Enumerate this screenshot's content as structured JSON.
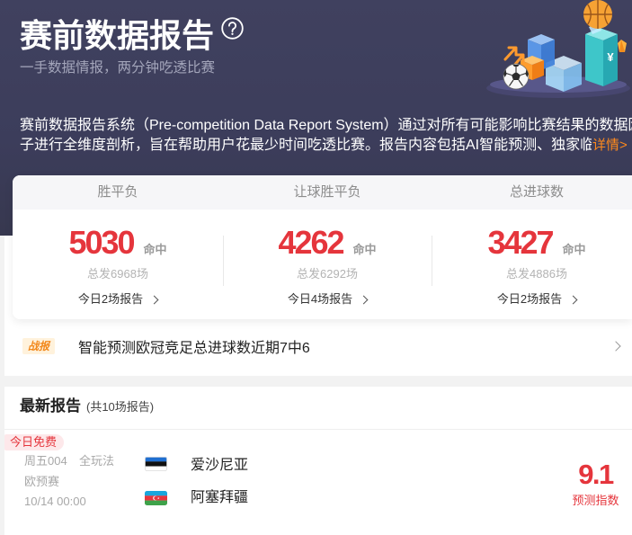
{
  "header": {
    "title": "赛前数据报告",
    "subtitle": "一手数据情报，两分钟吃透比赛",
    "description_lines": [
      "赛前数据报告系统（Pre-competition Data Report System）通过对所有可能影响比赛结果的数据因",
      "子进行全维度剖析，旨在帮助用户花最少时间吃透比赛。报告内容包括AI智能预测、独家临"
    ],
    "details_link": "详情>",
    "illustration": {
      "currency_symbol": "¥"
    }
  },
  "stats": {
    "columns": [
      {
        "label": "胜平负",
        "hits": "5030",
        "hit_label": "命中",
        "total": "总发6968场",
        "today": "今日2场报告"
      },
      {
        "label": "让球胜平负",
        "hits": "4262",
        "hit_label": "命中",
        "total": "总发6292场",
        "today": "今日4场报告"
      },
      {
        "label": "总进球数",
        "hits": "3427",
        "hit_label": "命中",
        "total": "总发4886场",
        "today": "今日2场报告"
      }
    ]
  },
  "news": {
    "badge": "战报",
    "text": "智能预测欧冠竞足总进球数近期7中6"
  },
  "latest": {
    "title": "最新报告",
    "count": "(共10场报告)",
    "matches": [
      {
        "tag": "今日免费",
        "match_no": "周五004",
        "play_type": "全玩法",
        "league": "欧预赛",
        "time": "10/14 00:00",
        "home": {
          "name": "爱沙尼亚",
          "flag": "estonia-flag"
        },
        "away": {
          "name": "阿塞拜疆",
          "flag": "azerbaijan-flag"
        },
        "index": "9.1",
        "index_label": "预测指数"
      }
    ]
  },
  "icons": {
    "help": "help-circle-icon",
    "chevron": "chevron-right-icon"
  },
  "colors": {
    "header_bg": "#3c3d5b",
    "accent_red": "#e5353c",
    "link_orange": "#ff8a1c",
    "badge_orange": "#f2891d",
    "badge_bg": "#fff2dc",
    "free_tag_bg": "#fde8ea"
  }
}
